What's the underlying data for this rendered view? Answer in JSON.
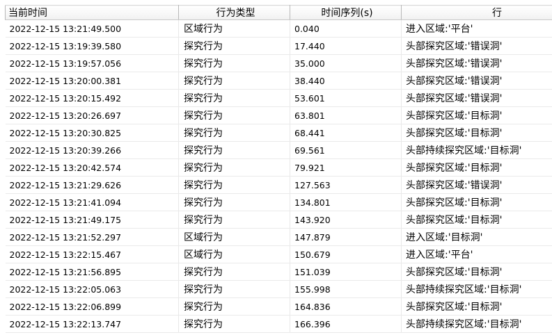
{
  "table": {
    "columns": [
      "当前时间",
      "行为类型",
      "时间序列(s)",
      "行"
    ],
    "rows": [
      {
        "time": "2022-12-15 13:21:49.500",
        "type": "区域行为",
        "seq": "0.040",
        "desc": "进入区域:'平台'"
      },
      {
        "time": "2022-12-15 13:19:39.580",
        "type": "探究行为",
        "seq": "17.440",
        "desc": "头部探究区域:'错误洞'"
      },
      {
        "time": "2022-12-15 13:19:57.056",
        "type": "探究行为",
        "seq": "35.000",
        "desc": "头部探究区域:'错误洞'"
      },
      {
        "time": "2022-12-15 13:20:00.381",
        "type": "探究行为",
        "seq": "38.440",
        "desc": "头部探究区域:'错误洞'"
      },
      {
        "time": "2022-12-15 13:20:15.492",
        "type": "探究行为",
        "seq": "53.601",
        "desc": "头部探究区域:'错误洞'"
      },
      {
        "time": "2022-12-15 13:20:26.697",
        "type": "探究行为",
        "seq": "63.801",
        "desc": "头部探究区域:'目标洞'"
      },
      {
        "time": "2022-12-15 13:20:30.825",
        "type": "探究行为",
        "seq": "68.441",
        "desc": "头部探究区域:'目标洞'"
      },
      {
        "time": "2022-12-15 13:20:39.266",
        "type": "探究行为",
        "seq": "69.561",
        "desc": "头部持续探究区域:'目标洞'"
      },
      {
        "time": "2022-12-15 13:20:42.574",
        "type": "探究行为",
        "seq": "79.921",
        "desc": "头部探究区域:'目标洞'"
      },
      {
        "time": "2022-12-15 13:21:29.626",
        "type": "探究行为",
        "seq": "127.563",
        "desc": "头部探究区域:'错误洞'"
      },
      {
        "time": "2022-12-15 13:21:41.094",
        "type": "探究行为",
        "seq": "134.801",
        "desc": "头部探究区域:'目标洞'"
      },
      {
        "time": "2022-12-15 13:21:49.175",
        "type": "探究行为",
        "seq": "143.920",
        "desc": "头部探究区域:'目标洞'"
      },
      {
        "time": "2022-12-15 13:21:52.297",
        "type": "区域行为",
        "seq": "147.879",
        "desc": "进入区域:'目标洞'"
      },
      {
        "time": "2022-12-15 13:22:15.467",
        "type": "区域行为",
        "seq": "150.679",
        "desc": "进入区域:'平台'"
      },
      {
        "time": "2022-12-15 13:21:56.895",
        "type": "探究行为",
        "seq": "151.039",
        "desc": "头部探究区域:'目标洞'"
      },
      {
        "time": "2022-12-15 13:22:05.063",
        "type": "探究行为",
        "seq": "155.998",
        "desc": "头部持续探究区域:'目标洞'"
      },
      {
        "time": "2022-12-15 13:22:06.899",
        "type": "探究行为",
        "seq": "164.836",
        "desc": "头部探究区域:'目标洞'"
      },
      {
        "time": "2022-12-15 13:22:13.747",
        "type": "探究行为",
        "seq": "166.396",
        "desc": "头部持续探究区域:'目标洞'"
      }
    ]
  }
}
